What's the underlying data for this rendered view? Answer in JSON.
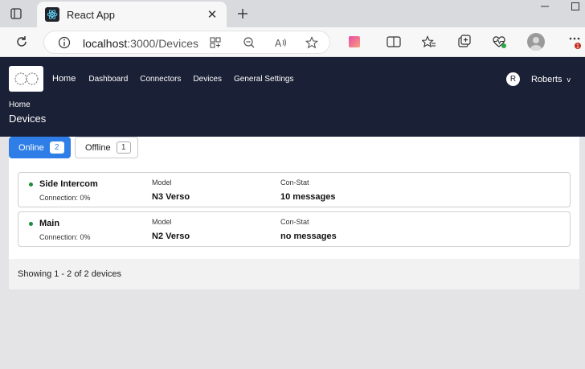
{
  "browser": {
    "tab_title": "React App",
    "url_host": "localhost",
    "url_rest": ":3000/Devices",
    "icons": [
      "tab-actions-icon",
      "react-favicon-icon",
      "close-icon",
      "new-tab-icon",
      "minimize-icon",
      "maximize-icon",
      "refresh-icon",
      "info-icon",
      "apps-icon",
      "zoom-out-icon",
      "read-aloud-icon",
      "favorite-star-icon",
      "collections-icon",
      "split-screen-icon",
      "favorites-icon",
      "browser-essentials-icon",
      "health-icon",
      "profile-icon",
      "more-icon"
    ],
    "notification_count": "1"
  },
  "header": {
    "nav": [
      "Home",
      "Dashboard",
      "Connectors",
      "Devices",
      "General Settings"
    ],
    "user_initial": "R",
    "user_name": "Roberts",
    "user_chevron": "v",
    "breadcrumb": "Home",
    "page_title": "Devices",
    "colors": {
      "header_bg": "#1a2036",
      "accent": "#2f7ee8",
      "online_dot": "#1f8a3a"
    }
  },
  "tabs": [
    {
      "label": "Online",
      "count": "2"
    },
    {
      "label": "Offline",
      "count": "1"
    }
  ],
  "devices": [
    {
      "name": "Side Intercom",
      "connection": "Connection: 0%",
      "model_label": "Model",
      "model": "N3 Verso",
      "stat_label": "Con-Stat",
      "stat": "10 messages"
    },
    {
      "name": "Main",
      "connection": "Connection: 0%",
      "model_label": "Model",
      "model": "N2 Verso",
      "stat_label": "Con-Stat",
      "stat": "no messages"
    }
  ],
  "footer": {
    "showing": "Showing 1 - 2 of 2 devices"
  }
}
